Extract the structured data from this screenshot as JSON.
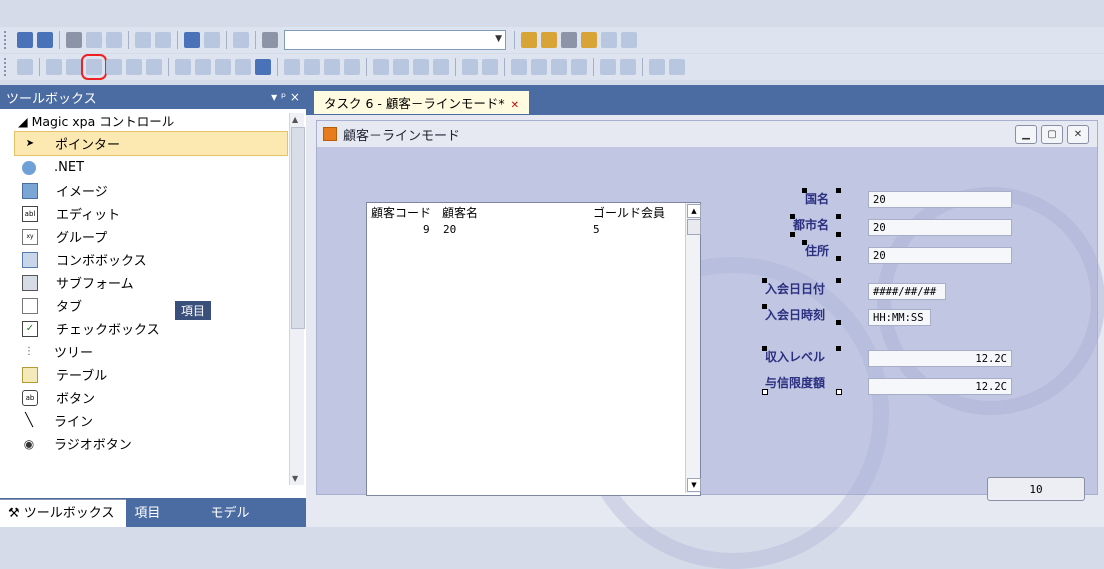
{
  "toolbar1": {
    "combo_value": ""
  },
  "toolbox": {
    "title": "ツールボックス",
    "pin": "▾ ᵖ ×",
    "group": "◢ Magic xpa コントロール",
    "items": [
      {
        "label": "ポインター",
        "icon": "pointer-icon"
      },
      {
        "label": ".NET",
        "icon": "dotnet-icon"
      },
      {
        "label": "イメージ",
        "icon": "image-icon"
      },
      {
        "label": "エディット",
        "icon": "edit-icon"
      },
      {
        "label": "グループ",
        "icon": "group-icon"
      },
      {
        "label": "コンボボックス",
        "icon": "combobox-icon"
      },
      {
        "label": "サブフォーム",
        "icon": "subform-icon"
      },
      {
        "label": "タブ",
        "icon": "tab-icon"
      },
      {
        "label": "チェックボックス",
        "icon": "checkbox-icon"
      },
      {
        "label": "ツリー",
        "icon": "tree-icon"
      },
      {
        "label": "テーブル",
        "icon": "table-icon"
      },
      {
        "label": "ボタン",
        "icon": "button-icon"
      },
      {
        "label": "ライン",
        "icon": "line-icon"
      },
      {
        "label": "ラジオボタン",
        "icon": "radio-icon"
      }
    ],
    "tooltip": "項目",
    "bottom_tabs": [
      "ツールボックス",
      "項目",
      "モデル"
    ]
  },
  "document": {
    "tab_label": "タスク 6 - 顧客－ラインモード*",
    "form_title": "顧客－ラインモード",
    "table": {
      "headers": [
        "顧客コード",
        "顧客名",
        "ゴールド会員"
      ],
      "row": [
        "9",
        "20",
        "5"
      ]
    },
    "fields": [
      {
        "label": "国名",
        "value": "20"
      },
      {
        "label": "都市名",
        "value": "20"
      },
      {
        "label": "住所",
        "value": "20"
      },
      {
        "label": "入会日日付",
        "value": "####/##/##"
      },
      {
        "label": "入会日時刻",
        "value": "HH:MM:SS"
      },
      {
        "label": "収入レベル",
        "value": "12.2C"
      },
      {
        "label": "与信限度額",
        "value": "12.2C"
      }
    ],
    "button_label": "10"
  },
  "colors": {
    "accent": "#4b6ca3",
    "selection": "#fce8b1",
    "form_bg": "#c1c6e2",
    "highlight_box": "#e22"
  }
}
